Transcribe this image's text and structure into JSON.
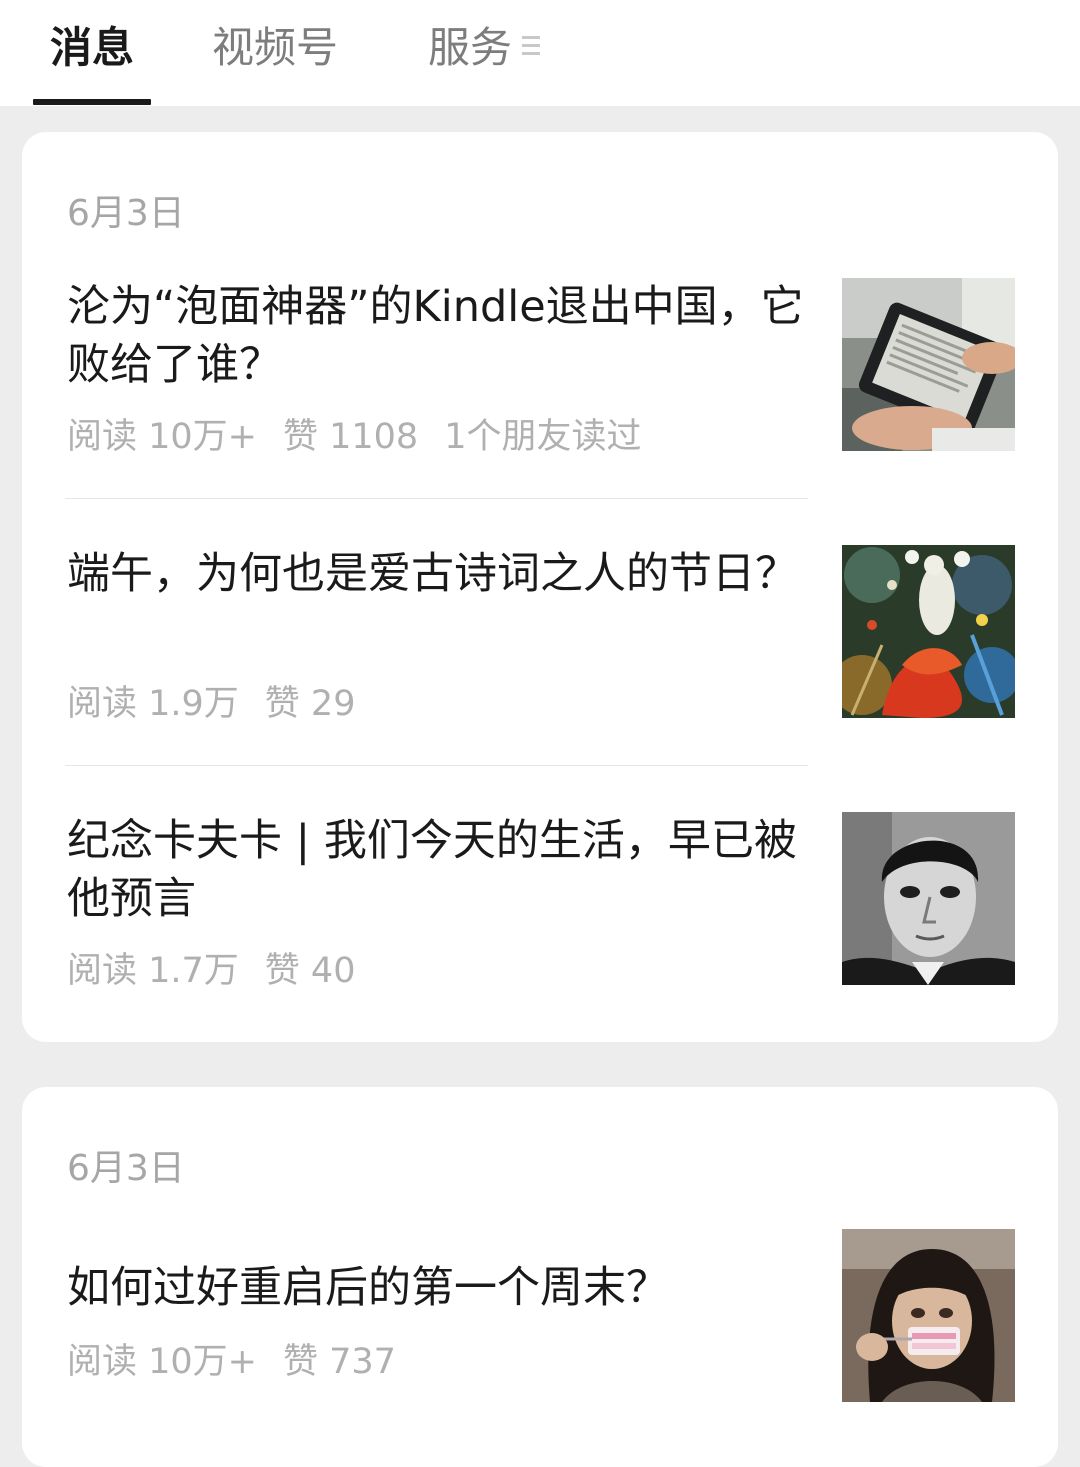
{
  "tabs": [
    {
      "label": "消息",
      "active": true
    },
    {
      "label": "视频号",
      "active": false
    },
    {
      "label": "服务",
      "active": false
    }
  ],
  "cards": [
    {
      "date": "6月3日",
      "articles": [
        {
          "title": "沦为“泡面神器”的Kindle退出中国，它败给了谁？",
          "reads": "阅读 10万+",
          "likes": "赞 1108",
          "friends": "1个朋友读过",
          "thumb": "kindle-thumbnail"
        },
        {
          "title": "端午，为何也是爱古诗词之人的节日？",
          "reads": "阅读 1.9万",
          "likes": "赞 29",
          "thumb": "painting-thumbnail"
        },
        {
          "title": "纪念卡夫卡 | 我们今天的生活，早已被他预言",
          "reads": "阅读 1.7万",
          "likes": "赞 40",
          "thumb": "portrait-thumbnail"
        }
      ]
    },
    {
      "date": "6月3日",
      "articles": [
        {
          "title": "如何过好重启后的第一个周末？",
          "reads": "阅读 10万+",
          "likes": "赞 737",
          "thumb": "girl-eating-thumbnail"
        }
      ]
    }
  ],
  "icons": {
    "tab_menu": "menu-lines-icon"
  },
  "colors": {
    "text": "#1a1a1a",
    "meta": "#b0b0b0",
    "date": "#a6a6a6",
    "background": "#ededed"
  }
}
